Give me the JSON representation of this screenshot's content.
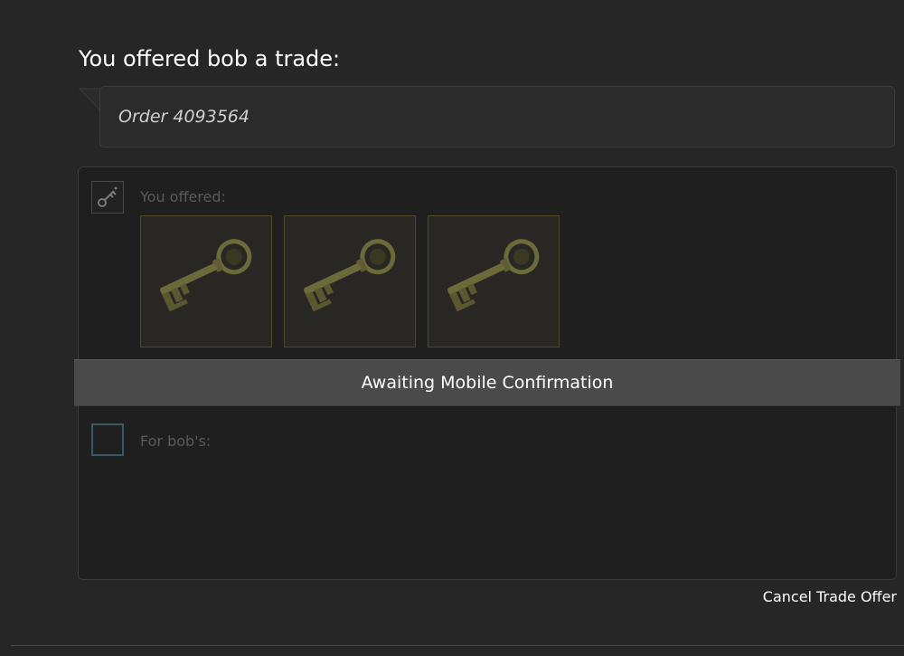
{
  "trade_offer": {
    "heading": "You offered bob a trade:",
    "message": "Order 4093564",
    "your_side": {
      "label": "You offered:",
      "avatar_icon": "key-icon",
      "items": [
        {
          "name": "key-item",
          "icon": "key-icon"
        },
        {
          "name": "key-item",
          "icon": "key-icon"
        },
        {
          "name": "key-item",
          "icon": "key-icon"
        }
      ]
    },
    "status": "Awaiting Mobile Confirmation",
    "their_side": {
      "label": "For bob's:",
      "avatar_icon": "avatar-placeholder",
      "items": []
    },
    "cancel_label": "Cancel Trade Offer"
  },
  "colors": {
    "background": "#262626",
    "panel": "#1f1f1f",
    "item_border": "#4f4726",
    "status_banner": "#4a4a4a",
    "key_gold": "#6b6a3a"
  }
}
